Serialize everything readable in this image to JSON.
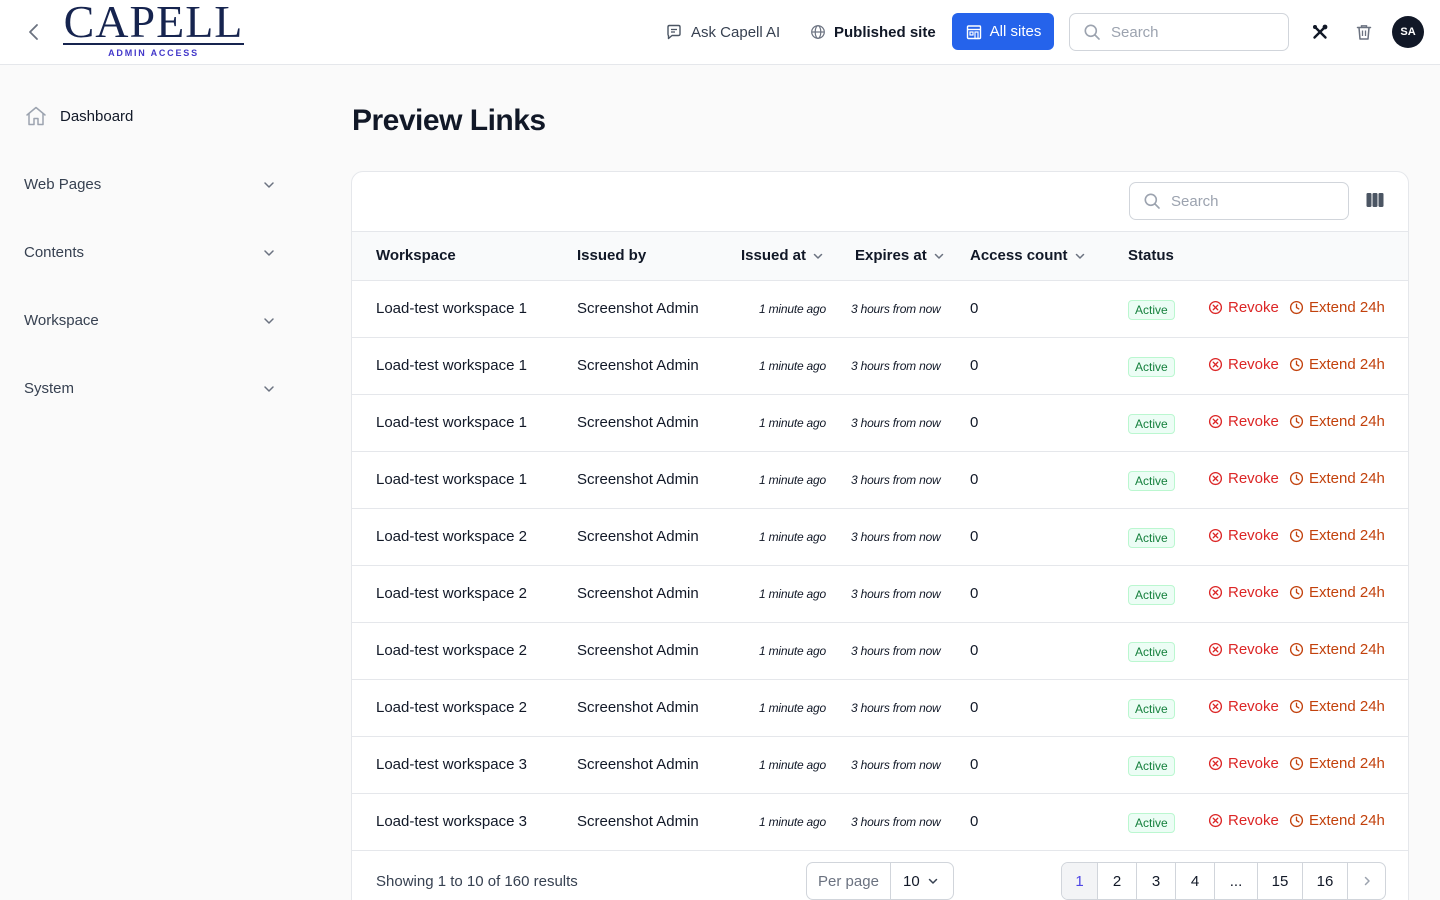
{
  "header": {
    "logo_text": "CAPELL",
    "logo_subtitle": "ADMIN ACCESS",
    "ask_ai_label": "Ask Capell AI",
    "published_label": "Published site",
    "all_sites_label": "All sites",
    "search_placeholder": "Search",
    "avatar_initials": "SA"
  },
  "sidebar": {
    "items": [
      {
        "label": "Dashboard",
        "icon": "home-icon"
      },
      {
        "label": "Web Pages",
        "icon": "chevron-down-icon"
      },
      {
        "label": "Contents",
        "icon": "chevron-down-icon"
      },
      {
        "label": "Workspace",
        "icon": "chevron-down-icon"
      },
      {
        "label": "System",
        "icon": "chevron-down-icon"
      }
    ]
  },
  "main": {
    "title": "Preview Links",
    "table_search_placeholder": "Search",
    "columns": [
      {
        "label": "Workspace",
        "sortable": false
      },
      {
        "label": "Issued by",
        "sortable": false
      },
      {
        "label": "Issued at",
        "sortable": true
      },
      {
        "label": "Expires at",
        "sortable": true
      },
      {
        "label": "Access count",
        "sortable": true
      },
      {
        "label": "Status",
        "sortable": false
      }
    ],
    "rows": [
      {
        "workspace": "Load-test workspace 1",
        "issued_by": "Screenshot Admin",
        "issued_at": "1 minute ago",
        "expires_at": "3 hours from now",
        "access_count": "0",
        "status": "Active"
      },
      {
        "workspace": "Load-test workspace 1",
        "issued_by": "Screenshot Admin",
        "issued_at": "1 minute ago",
        "expires_at": "3 hours from now",
        "access_count": "0",
        "status": "Active"
      },
      {
        "workspace": "Load-test workspace 1",
        "issued_by": "Screenshot Admin",
        "issued_at": "1 minute ago",
        "expires_at": "3 hours from now",
        "access_count": "0",
        "status": "Active"
      },
      {
        "workspace": "Load-test workspace 1",
        "issued_by": "Screenshot Admin",
        "issued_at": "1 minute ago",
        "expires_at": "3 hours from now",
        "access_count": "0",
        "status": "Active"
      },
      {
        "workspace": "Load-test workspace 2",
        "issued_by": "Screenshot Admin",
        "issued_at": "1 minute ago",
        "expires_at": "3 hours from now",
        "access_count": "0",
        "status": "Active"
      },
      {
        "workspace": "Load-test workspace 2",
        "issued_by": "Screenshot Admin",
        "issued_at": "1 minute ago",
        "expires_at": "3 hours from now",
        "access_count": "0",
        "status": "Active"
      },
      {
        "workspace": "Load-test workspace 2",
        "issued_by": "Screenshot Admin",
        "issued_at": "1 minute ago",
        "expires_at": "3 hours from now",
        "access_count": "0",
        "status": "Active"
      },
      {
        "workspace": "Load-test workspace 2",
        "issued_by": "Screenshot Admin",
        "issued_at": "1 minute ago",
        "expires_at": "3 hours from now",
        "access_count": "0",
        "status": "Active"
      },
      {
        "workspace": "Load-test workspace 3",
        "issued_by": "Screenshot Admin",
        "issued_at": "1 minute ago",
        "expires_at": "3 hours from now",
        "access_count": "0",
        "status": "Active"
      },
      {
        "workspace": "Load-test workspace 3",
        "issued_by": "Screenshot Admin",
        "issued_at": "1 minute ago",
        "expires_at": "3 hours from now",
        "access_count": "0",
        "status": "Active"
      }
    ],
    "row_actions": {
      "revoke": "Revoke",
      "extend": "Extend 24h"
    },
    "footer": {
      "showing_text": "Showing 1 to 10 of 160 results",
      "per_page_label": "Per page",
      "per_page_value": "10",
      "pages": [
        "1",
        "2",
        "3",
        "4",
        "...",
        "15",
        "16"
      ],
      "current_page": "1"
    }
  },
  "colors": {
    "accent": "#2563eb",
    "revoke": "#dc2626",
    "extend": "#c2410c",
    "status_active": "#15803d",
    "logo": "#16244f"
  }
}
